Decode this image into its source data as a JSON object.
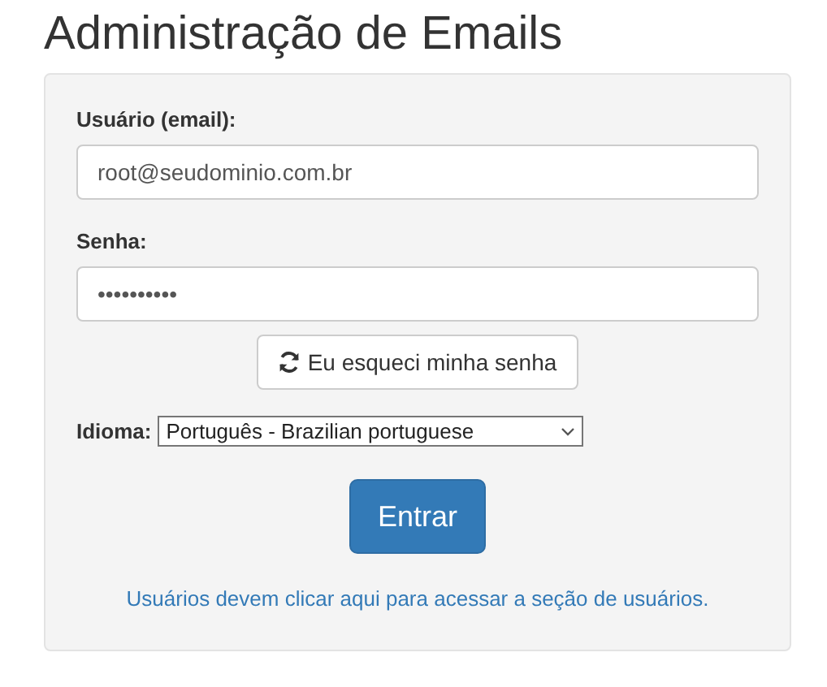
{
  "title": "Administração de Emails",
  "fields": [
    {
      "label": "Usuário (email):",
      "value": "root@seudominio.com.br"
    },
    {
      "label": "Senha:",
      "value": "••••••••••"
    }
  ],
  "reset_button": {
    "label": "Eu esqueci minha senha"
  },
  "language": {
    "label": "Idioma:",
    "value": "Português - Brazilian portuguese"
  },
  "submit_button": {
    "label": "Entrar"
  },
  "users_link": "Usuários devem clicar aqui para acessar a seção de usuários."
}
